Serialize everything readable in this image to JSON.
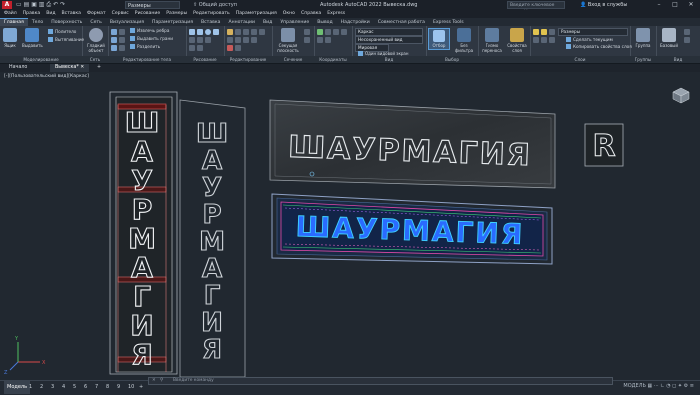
{
  "titlebar": {
    "app_logo": "A",
    "workspace": "Размеры",
    "share": "Общий доступ",
    "title": "Autodesk AutoCAD 2022  Вывеска.dwg",
    "search_placeholder": "Введите ключевое слово/фразу",
    "signin": "Вход в службы",
    "minimize": "–",
    "maximize": "□",
    "close": "✕"
  },
  "menubar": [
    "Файл",
    "Правка",
    "Вид",
    "Вставка",
    "Формат",
    "Сервис",
    "Рисование",
    "Размеры",
    "Редактировать",
    "Параметризация",
    "Окно",
    "Справка",
    "Express"
  ],
  "ribbon_tabs": [
    "Главная",
    "Тело",
    "Поверхность",
    "Сеть",
    "Визуализация",
    "Параметризация",
    "Вставка",
    "Аннотации",
    "Вид",
    "Управление",
    "Вывод",
    "Надстройки",
    "Совместная работа",
    "Express Tools"
  ],
  "ribbon": {
    "model_panel": {
      "btn1": "Ящик",
      "btn2": "Выдавить",
      "row1": "Политело",
      "row2": "Вытягивание",
      "label": "Моделирование"
    },
    "mesh_panel": {
      "btn": "Гладкий объект",
      "label": "Сеть"
    },
    "solid_edit": {
      "row1": "Извлечь ребра",
      "row2": "Выдавить грани",
      "row3": "Разделить",
      "label": "Редактирование тела"
    },
    "draw": {
      "label": "Рисование"
    },
    "modify": {
      "label": "Редактирование"
    },
    "section": {
      "btn": "Секущая плоскость",
      "label": "Сечение"
    },
    "coords": {
      "label": "Координаты"
    },
    "view": {
      "dd1": "Каркас",
      "dd2": "Несохраненный вид",
      "dd3": "Мировая",
      "dd4": "Один видовой экран",
      "label": "Вид"
    },
    "selection": {
      "btn1": "Отбор",
      "btn2": "Без фильтра",
      "label": "Выбор"
    },
    "gizmo": {
      "btn": "Гизмо переноса",
      "btn2": "Свойства слоя"
    },
    "layers": {
      "dd": "Размеры",
      "row1": "Сделать текущим",
      "row2": "Копировать свойства слоя",
      "label": "Слои"
    },
    "groups": {
      "btn": "Группа",
      "label": "Группы"
    },
    "views": {
      "btn": "Базовый",
      "label": "Вид"
    }
  },
  "filetabs": {
    "start": "Начало",
    "active": "Вывеска*",
    "add": "+"
  },
  "viewport": {
    "label": "[-][Пользовательский вид][Каркас]",
    "sign_text": "ШАУРМАГИЯ",
    "vertical_text": [
      "Ш",
      "А",
      "У",
      "Р",
      "М",
      "А",
      "Г",
      "И",
      "Я"
    ],
    "letter_r": "R",
    "ucs_x": "X",
    "ucs_y": "Y",
    "ucs_z": "Z"
  },
  "statusbar": {
    "layouts": [
      "Модель",
      "1",
      "2",
      "3",
      "4",
      "5",
      "6",
      "7",
      "8",
      "9",
      "10",
      "+"
    ],
    "cmd_placeholder": "Введите команду",
    "model_label": "МОДЕЛЬ"
  },
  "colors": {
    "bg": "#212830",
    "ribbon": "#2f3742",
    "accent": "#5a9bd5",
    "neon": "#2a6bff",
    "neon_edge": "#3fd2ff"
  }
}
